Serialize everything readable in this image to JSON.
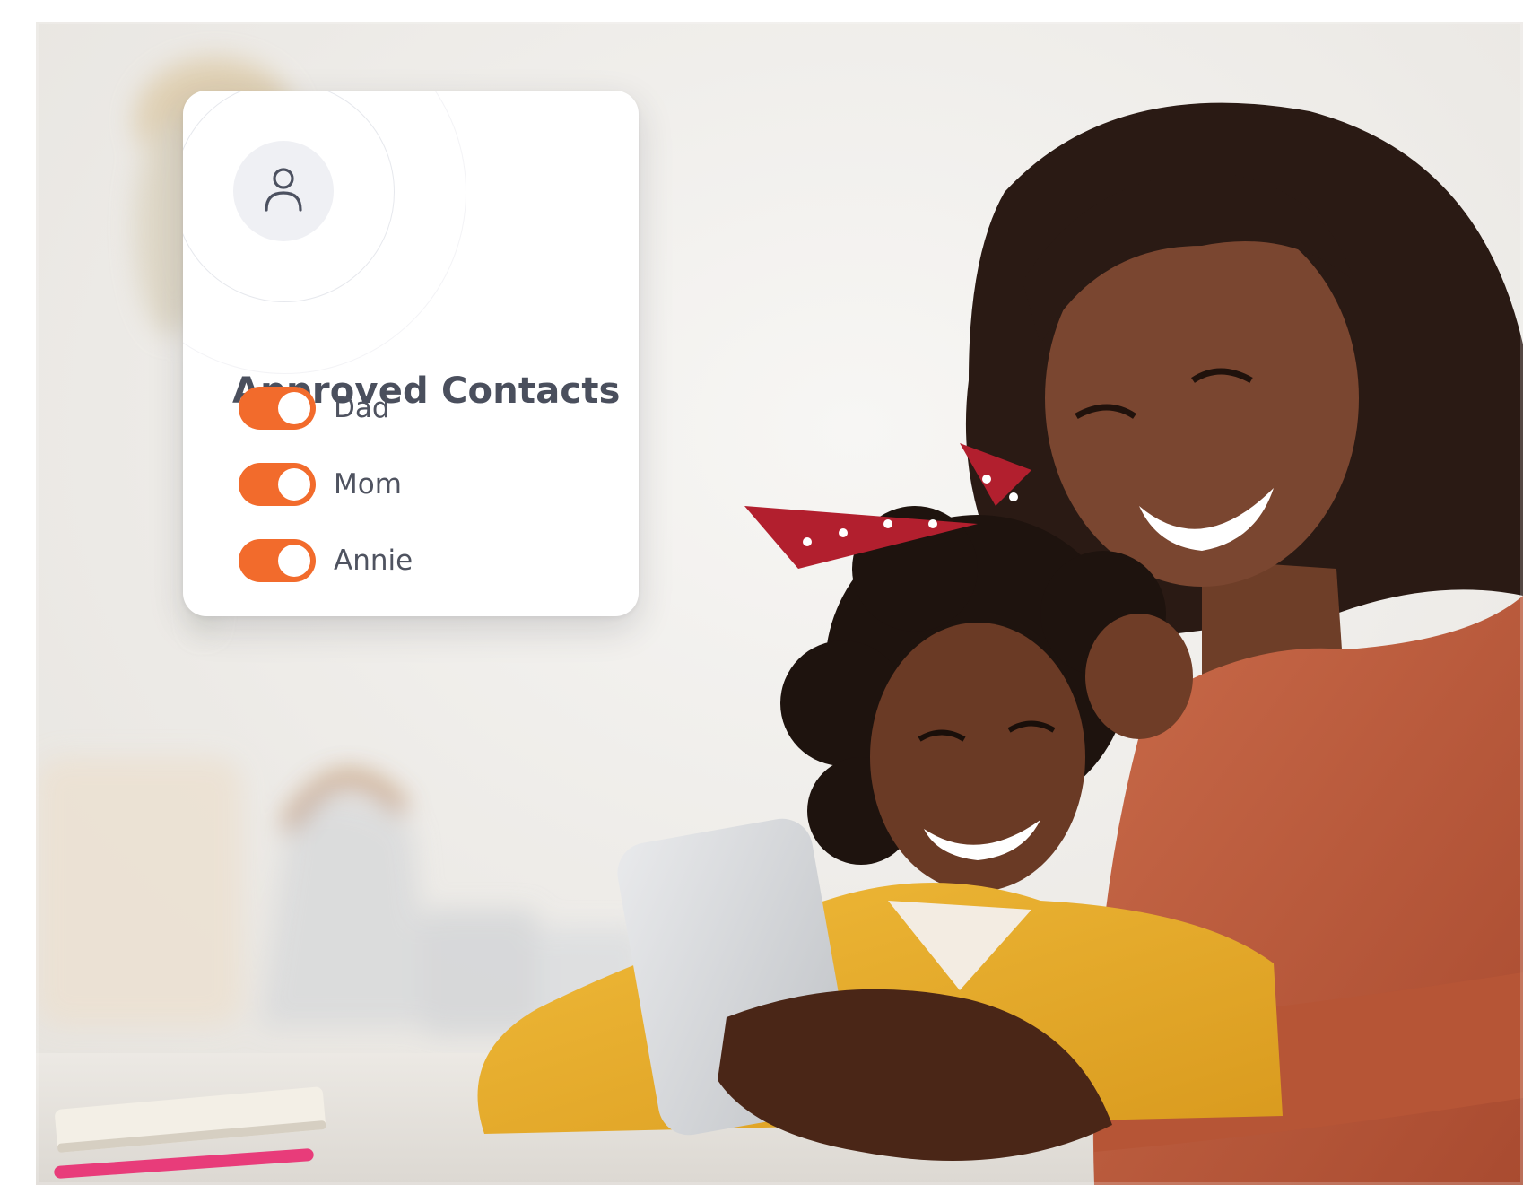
{
  "contacts_card": {
    "title": "Approved Contacts",
    "icon": "user-icon",
    "accent_color": "#f26b2c",
    "contacts": [
      {
        "name": "Dad",
        "enabled": true
      },
      {
        "name": "Mom",
        "enabled": true
      },
      {
        "name": "Annie",
        "enabled": true
      }
    ]
  }
}
